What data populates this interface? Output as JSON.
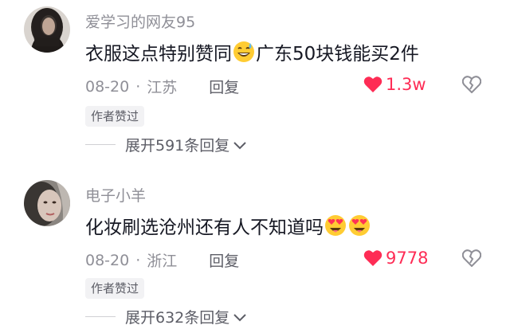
{
  "comments": [
    {
      "username": "爱学习的网友95",
      "text_before_emoji": "衣服这点特别赞同",
      "emoji": "sweat-smile-emoji",
      "text_after_emoji": "广东50块钱能买2件",
      "date": "08-20",
      "location": "江苏",
      "reply_label": "回复",
      "likes": "1.3w",
      "badge": "作者赞过",
      "expand_label": "展开591条回复"
    },
    {
      "username": "电子小羊",
      "text_before_emoji": "化妆刷选沧州还有人不知道吗",
      "emoji": "heart-eyes-emoji",
      "text_after_emoji": "",
      "date": "08-20",
      "location": "浙江",
      "reply_label": "回复",
      "likes": "9778",
      "badge": "作者赞过",
      "expand_label": "展开632条回复"
    }
  ],
  "separator": "·",
  "colors": {
    "like_red": "#fe2c55",
    "username_gray": "#8f8f97",
    "text_dark": "#161823"
  }
}
